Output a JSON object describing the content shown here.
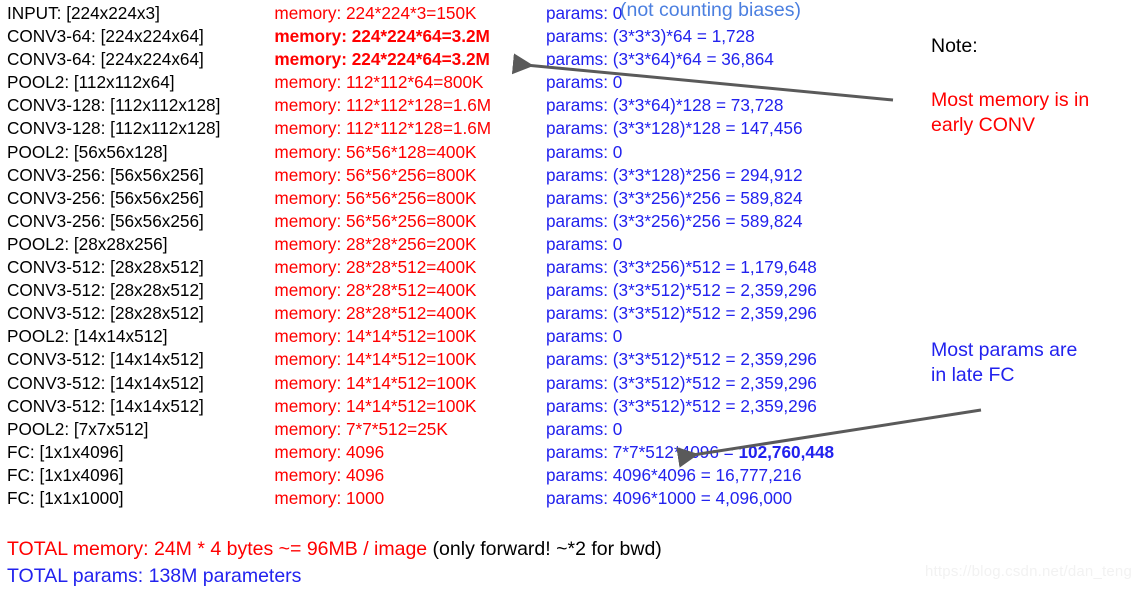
{
  "watermark": "https://blog.csdn.net/dan_teng",
  "annotations": {
    "biases": "(not counting biases)",
    "note_label": "Note:",
    "memory_note": "Most memory is in\nearly CONV",
    "params_note": "Most params are\nin late FC"
  },
  "totals": {
    "memory_main": "TOTAL memory: 24M * 4 bytes ~= 96MB / image",
    "memory_tail": " (only forward! ~*2 for bwd)",
    "params": "TOTAL params: 138M parameters"
  },
  "colors": {
    "layer_name": "#000000",
    "memory": "#ff0000",
    "params": "#2222ee",
    "biases_note": "#4b7fe0",
    "arrow": "#5a5a5a",
    "watermark": "#f2f2f2"
  },
  "layers": [
    {
      "name": "INPUT: [224x224x3]",
      "memory": "memory:  224*224*3=150K",
      "memory_bold": false,
      "params": "params: 0",
      "params_bold": false
    },
    {
      "name": "CONV3-64: [224x224x64]",
      "memory": "memory:  224*224*64=3.2M",
      "memory_bold": true,
      "params": "params: (3*3*3)*64 = 1,728",
      "params_bold": false
    },
    {
      "name": "CONV3-64: [224x224x64]",
      "memory": "memory:  224*224*64=3.2M",
      "memory_bold": true,
      "params": "params: (3*3*64)*64 = 36,864",
      "params_bold": false
    },
    {
      "name": "POOL2: [112x112x64]",
      "memory": "memory:  112*112*64=800K",
      "memory_bold": false,
      "params": "params: 0",
      "params_bold": false
    },
    {
      "name": "CONV3-128: [112x112x128]",
      "memory": "memory:  112*112*128=1.6M",
      "memory_bold": false,
      "params": "params: (3*3*64)*128 = 73,728",
      "params_bold": false
    },
    {
      "name": "CONV3-128: [112x112x128]",
      "memory": "memory:  112*112*128=1.6M",
      "memory_bold": false,
      "params": "params: (3*3*128)*128 = 147,456",
      "params_bold": false
    },
    {
      "name": "POOL2: [56x56x128]",
      "memory": "memory:  56*56*128=400K",
      "memory_bold": false,
      "params": "params: 0",
      "params_bold": false
    },
    {
      "name": "CONV3-256: [56x56x256]",
      "memory": "memory:  56*56*256=800K",
      "memory_bold": false,
      "params": "params: (3*3*128)*256 = 294,912",
      "params_bold": false
    },
    {
      "name": "CONV3-256: [56x56x256]",
      "memory": "memory:  56*56*256=800K",
      "memory_bold": false,
      "params": "params: (3*3*256)*256 = 589,824",
      "params_bold": false
    },
    {
      "name": "CONV3-256: [56x56x256]",
      "memory": "memory:  56*56*256=800K",
      "memory_bold": false,
      "params": "params: (3*3*256)*256 = 589,824",
      "params_bold": false
    },
    {
      "name": "POOL2: [28x28x256]",
      "memory": "memory:  28*28*256=200K",
      "memory_bold": false,
      "params": "params: 0",
      "params_bold": false
    },
    {
      "name": "CONV3-512: [28x28x512]",
      "memory": "memory:  28*28*512=400K",
      "memory_bold": false,
      "params": "params: (3*3*256)*512 = 1,179,648",
      "params_bold": false
    },
    {
      "name": "CONV3-512: [28x28x512]",
      "memory": "memory:  28*28*512=400K",
      "memory_bold": false,
      "params": "params: (3*3*512)*512 = 2,359,296",
      "params_bold": false
    },
    {
      "name": "CONV3-512: [28x28x512]",
      "memory": "memory:  28*28*512=400K",
      "memory_bold": false,
      "params": "params: (3*3*512)*512 = 2,359,296",
      "params_bold": false
    },
    {
      "name": "POOL2: [14x14x512]",
      "memory": "memory:  14*14*512=100K",
      "memory_bold": false,
      "params": "params: 0",
      "params_bold": false
    },
    {
      "name": "CONV3-512: [14x14x512]",
      "memory": "memory:  14*14*512=100K",
      "memory_bold": false,
      "params": "params: (3*3*512)*512 = 2,359,296",
      "params_bold": false
    },
    {
      "name": "CONV3-512: [14x14x512]",
      "memory": "memory:  14*14*512=100K",
      "memory_bold": false,
      "params": "params: (3*3*512)*512 = 2,359,296",
      "params_bold": false
    },
    {
      "name": "CONV3-512: [14x14x512]",
      "memory": "memory:  14*14*512=100K",
      "memory_bold": false,
      "params": "params: (3*3*512)*512 = 2,359,296",
      "params_bold": false
    },
    {
      "name": "POOL2: [7x7x512]",
      "memory": "memory:  7*7*512=25K",
      "memory_bold": false,
      "params": "params: 0",
      "params_bold": false
    },
    {
      "name": "FC: [1x1x4096]",
      "memory": "memory:  4096",
      "memory_bold": false,
      "params": "params: 7*7*512*4096 = ",
      "params_bold": false,
      "params_bold_tail": "102,760,448"
    },
    {
      "name": "FC: [1x1x4096]",
      "memory": "memory:  4096",
      "memory_bold": false,
      "params": "params: 4096*4096 = 16,777,216",
      "params_bold": false
    },
    {
      "name": "FC: [1x1x1000]",
      "memory": "memory:  1000",
      "memory_bold": false,
      "params": "params: 4096*1000 = 4,096,000",
      "params_bold": false
    }
  ]
}
